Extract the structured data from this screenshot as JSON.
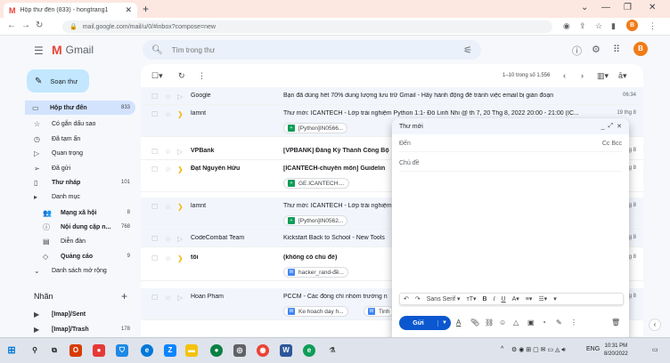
{
  "browser": {
    "tab_title": "Hộp thư đến (833) - hongtrang1",
    "url": "mail.google.com/mail/u/0/#inbox?compose=new",
    "profile_initial": "B"
  },
  "gmail": {
    "logo_text": "Gmail",
    "search_placeholder": "Tìm trong thư",
    "avatar_initial": "B"
  },
  "sidebar": {
    "compose_label": "Soạn thư",
    "items": [
      {
        "icon": "inbox-icon",
        "glyph": "▭",
        "label": "Hộp thư đến",
        "count": "833",
        "active": true,
        "bold": true
      },
      {
        "icon": "star-icon",
        "glyph": "☆",
        "label": "Có gắn dấu sao",
        "count": "",
        "active": false,
        "bold": false
      },
      {
        "icon": "clock-icon",
        "glyph": "◷",
        "label": "Đã tạm ẩn",
        "count": "",
        "active": false,
        "bold": false
      },
      {
        "icon": "important-icon",
        "glyph": "▷",
        "label": "Quan trọng",
        "count": "",
        "active": false,
        "bold": false
      },
      {
        "icon": "send-icon",
        "glyph": "➢",
        "label": "Đã gửi",
        "count": "",
        "active": false,
        "bold": false
      },
      {
        "icon": "draft-icon",
        "glyph": "▯",
        "label": "Thư nháp",
        "count": "101",
        "active": false,
        "bold": true
      },
      {
        "icon": "category-icon",
        "glyph": "▸",
        "label": "Danh mục",
        "count": "",
        "active": false,
        "bold": false
      },
      {
        "icon": "social-icon",
        "glyph": "👥",
        "label": "Mạng xã hội",
        "count": "8",
        "active": false,
        "bold": true,
        "sub": true
      },
      {
        "icon": "info-icon",
        "glyph": "ⓘ",
        "label": "Nội dung cập n...",
        "count": "768",
        "active": false,
        "bold": true,
        "sub": true
      },
      {
        "icon": "forum-icon",
        "glyph": "▤",
        "label": "Diễn đàn",
        "count": "",
        "active": false,
        "bold": false,
        "sub": true
      },
      {
        "icon": "promo-icon",
        "glyph": "◇",
        "label": "Quảng cáo",
        "count": "9",
        "active": false,
        "bold": true,
        "sub": true
      },
      {
        "icon": "expand-icon",
        "glyph": "⌄",
        "label": "Danh sách mở rộng",
        "count": "",
        "active": false,
        "bold": false
      }
    ],
    "labels_title": "Nhãn",
    "label_items": [
      {
        "label": "[Imap]/Sent",
        "count": ""
      },
      {
        "label": "[Imap]/Trash",
        "count": "178"
      }
    ]
  },
  "toolbar": {
    "page_count": "1–10 trong số 1.556"
  },
  "messages": [
    {
      "sender": "Google",
      "subject": "Bạn đã dùng hết 70% dung lượng lưu trữ Gmail - Hãy hành động để tránh việc email bị gián đoạn",
      "date": "06:34",
      "important": false,
      "unread": false,
      "chip": ""
    },
    {
      "sender": "lamnt",
      "subject": "Thư mời: ICANTECH - Lớp trải nghiệm Python 1:1- Đỗ Linh Nhi @ th 7, 20 Thg 8, 2022 20:00 - 21:00 (IC...",
      "date": "19 thg 8",
      "important": true,
      "unread": false,
      "chip": "[Python]IN0566...",
      "chip_type": "sheet"
    },
    {
      "sender": "VPBank",
      "subject": "[VPBANK] Đăng Ký Thành Công Bộ",
      "date": "g 8",
      "important": false,
      "unread": true,
      "chip": ""
    },
    {
      "sender": "Đạt Nguyễn Hữu",
      "subject": "[ICANTECH-chuyên môn] Guidelin",
      "date": "g 8",
      "important": true,
      "unread": true,
      "chip": "GE.ICANTECH....",
      "chip_type": "sheet"
    },
    {
      "sender": "lamnt",
      "subject": "Thư mời: ICANTECH - Lớp trải nghiệm",
      "date": "g 8",
      "important": true,
      "unread": false,
      "chip": "[Python]IN0562...",
      "chip_type": "sheet"
    },
    {
      "sender": "CodeCombat Team",
      "subject": "Kickstart Back to School - New Tools",
      "date": "g 8",
      "important": false,
      "unread": false,
      "chip": ""
    },
    {
      "sender": "tôi",
      "subject": "(không có chủ đề)",
      "date": "g 8",
      "important": true,
      "unread": true,
      "chip": "hacker_rand-đề...",
      "chip_type": "doc"
    },
    {
      "sender": "Hoan Pham",
      "subject": "PCCM - Các đồng chí nhóm trưởng n",
      "date": "g 8",
      "important": false,
      "unread": false,
      "chip": "Ke hoach day h...",
      "chip_type": "doc",
      "chip2": "Tinh"
    }
  ],
  "compose": {
    "title": "Thư mới",
    "to_label": "Đến",
    "cc_bcc": "Cc Bcc",
    "subject_label": "Chủ đề",
    "font": "Sans Serif",
    "send_label": "Gửi"
  },
  "taskbar": {
    "language": "ENG",
    "time": "10:31 PM",
    "date": "8/20/2022"
  },
  "colors": {
    "accent": "#0b57d0",
    "compose_button": "#c2e7ff",
    "active_nav": "#d3e3fd",
    "important_marker": "#f4b400"
  }
}
